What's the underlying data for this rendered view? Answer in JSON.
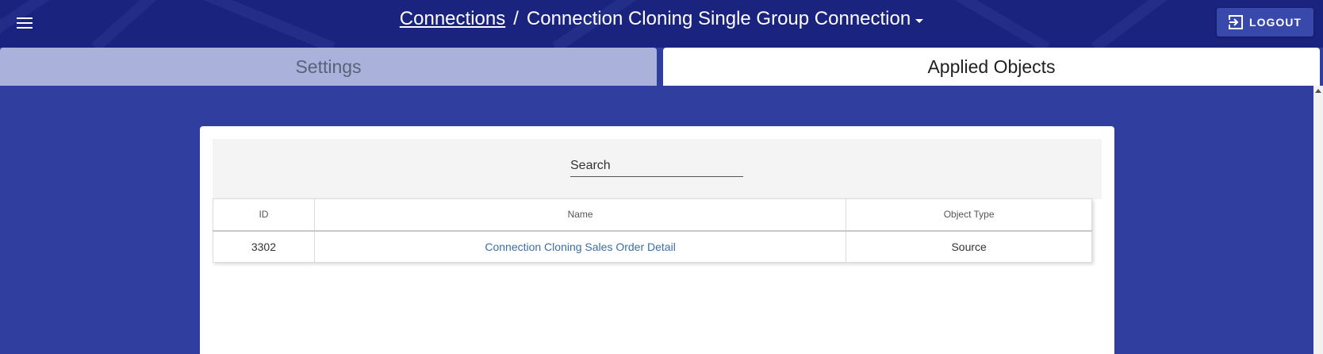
{
  "header": {
    "breadcrumb_root": "Connections",
    "separator": "/",
    "current": "Connection Cloning Single Group Connection",
    "logout_label": "LOGOUT",
    "menu_icon": "menu-icon",
    "logout_icon": "exit-icon",
    "dropdown_icon": "caret-down-icon"
  },
  "tabs": [
    {
      "label": "Settings",
      "active": false
    },
    {
      "label": "Applied Objects",
      "active": true
    }
  ],
  "search": {
    "placeholder": "Search",
    "value": ""
  },
  "table": {
    "columns": [
      "ID",
      "Name",
      "Object Type"
    ],
    "rows": [
      {
        "id": "3302",
        "name": "Connection Cloning Sales Order Detail",
        "object_type": "Source"
      }
    ]
  },
  "colors": {
    "header_bg": "#1a237e",
    "page_bg": "#303f9f",
    "inactive_tab": "#aab2dc",
    "link": "#3b6ea8"
  }
}
